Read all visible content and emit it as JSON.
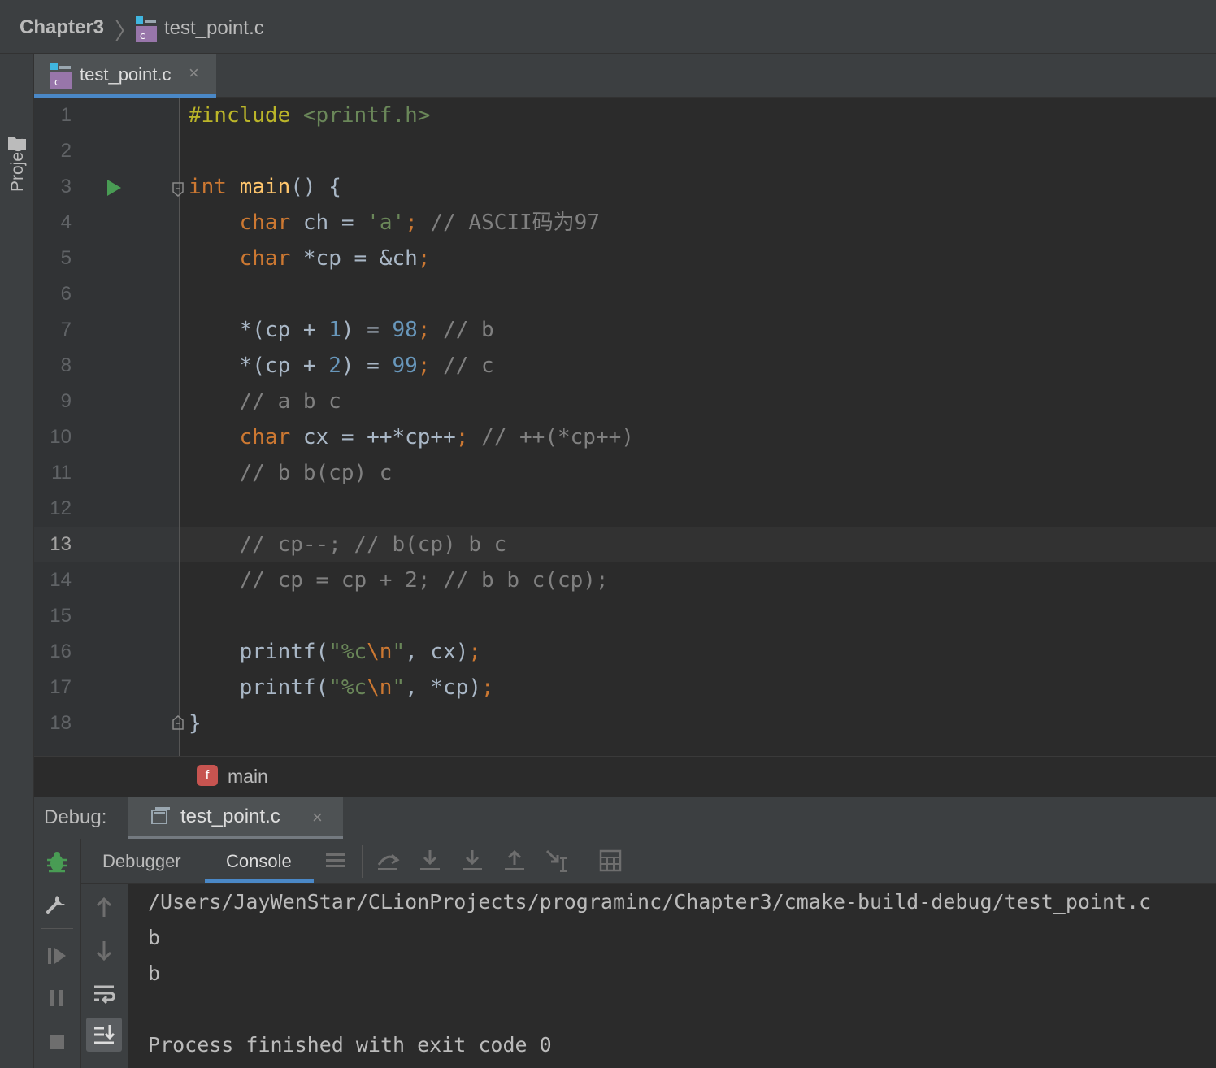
{
  "navbar": {
    "project": "Chapter3",
    "file": "test_point.c"
  },
  "sidebar": {
    "project_label": "Project"
  },
  "editor_tab": {
    "label": "test_point.c",
    "close": "×"
  },
  "editor": {
    "line_numbers": [
      "1",
      "2",
      "3",
      "4",
      "5",
      "6",
      "7",
      "8",
      "9",
      "10",
      "11",
      "12",
      "13",
      "14",
      "15",
      "16",
      "17",
      "18"
    ],
    "current_line": 13,
    "lines": [
      {
        "p": [
          {
            "t": "#include",
            "c": "pp"
          },
          {
            "t": " ",
            "c": ""
          },
          {
            "t": "<printf.h>",
            "c": "str"
          }
        ]
      },
      {
        "p": []
      },
      {
        "p": [
          {
            "t": "int",
            "c": "kw"
          },
          {
            "t": " ",
            "c": ""
          },
          {
            "t": "main",
            "c": "fn"
          },
          {
            "t": "() {",
            "c": ""
          }
        ]
      },
      {
        "p": [
          {
            "t": "    ",
            "c": ""
          },
          {
            "t": "char",
            "c": "kw"
          },
          {
            "t": " ch = ",
            "c": ""
          },
          {
            "t": "'a'",
            "c": "str"
          },
          {
            "t": ";",
            "c": "kw"
          },
          {
            "t": " // ASCII码为97",
            "c": "cmt"
          }
        ]
      },
      {
        "p": [
          {
            "t": "    ",
            "c": ""
          },
          {
            "t": "char",
            "c": "kw"
          },
          {
            "t": " *cp = &ch",
            "c": ""
          },
          {
            "t": ";",
            "c": "kw"
          }
        ]
      },
      {
        "p": []
      },
      {
        "p": [
          {
            "t": "    *(cp + ",
            "c": ""
          },
          {
            "t": "1",
            "c": "num"
          },
          {
            "t": ") = ",
            "c": ""
          },
          {
            "t": "98",
            "c": "num"
          },
          {
            "t": ";",
            "c": "kw"
          },
          {
            "t": " // b",
            "c": "cmt"
          }
        ]
      },
      {
        "p": [
          {
            "t": "    *(cp + ",
            "c": ""
          },
          {
            "t": "2",
            "c": "num"
          },
          {
            "t": ") = ",
            "c": ""
          },
          {
            "t": "99",
            "c": "num"
          },
          {
            "t": ";",
            "c": "kw"
          },
          {
            "t": " // c",
            "c": "cmt"
          }
        ]
      },
      {
        "p": [
          {
            "t": "    // a b c",
            "c": "cmt"
          }
        ]
      },
      {
        "p": [
          {
            "t": "    ",
            "c": ""
          },
          {
            "t": "char",
            "c": "kw"
          },
          {
            "t": " cx = ++*cp++",
            "c": ""
          },
          {
            "t": ";",
            "c": "kw"
          },
          {
            "t": " // ++(*cp++)",
            "c": "cmt"
          }
        ]
      },
      {
        "p": [
          {
            "t": "    // b b(cp) c",
            "c": "cmt"
          }
        ]
      },
      {
        "p": []
      },
      {
        "p": [
          {
            "t": "    // cp--; // b(cp) b c",
            "c": "cmt"
          }
        ]
      },
      {
        "p": [
          {
            "t": "    // cp = cp + 2; // b b c(cp);",
            "c": "cmt"
          }
        ]
      },
      {
        "p": []
      },
      {
        "p": [
          {
            "t": "    printf(",
            "c": ""
          },
          {
            "t": "\"%c",
            "c": "str"
          },
          {
            "t": "\\n",
            "c": "esc"
          },
          {
            "t": "\"",
            "c": "str"
          },
          {
            "t": ", cx)",
            "c": ""
          },
          {
            "t": ";",
            "c": "kw"
          }
        ]
      },
      {
        "p": [
          {
            "t": "    printf(",
            "c": ""
          },
          {
            "t": "\"%c",
            "c": "str"
          },
          {
            "t": "\\n",
            "c": "esc"
          },
          {
            "t": "\"",
            "c": "str"
          },
          {
            "t": ", *cp)",
            "c": ""
          },
          {
            "t": ";",
            "c": "kw"
          }
        ]
      },
      {
        "p": [
          {
            "t": "}",
            "c": ""
          }
        ]
      }
    ]
  },
  "structure": {
    "badge": "f",
    "function": "main"
  },
  "debug": {
    "label": "Debug:",
    "tab": "test_point.c",
    "close": "×",
    "subtabs": {
      "debugger": "Debugger",
      "console": "Console"
    }
  },
  "console": {
    "lines": [
      "/Users/JayWenStar/CLionProjects/programinc/Chapter3/cmake-build-debug/test_point.c",
      "b",
      "b",
      "",
      "Process finished with exit code 0"
    ]
  },
  "colors": {
    "keyword": "#cc7832",
    "preprocessor": "#bbb529",
    "string": "#6a8759",
    "number": "#6897bb",
    "comment": "#808080",
    "function": "#ffc66d",
    "run_marker": "#499c54",
    "accent": "#4a88c7"
  }
}
